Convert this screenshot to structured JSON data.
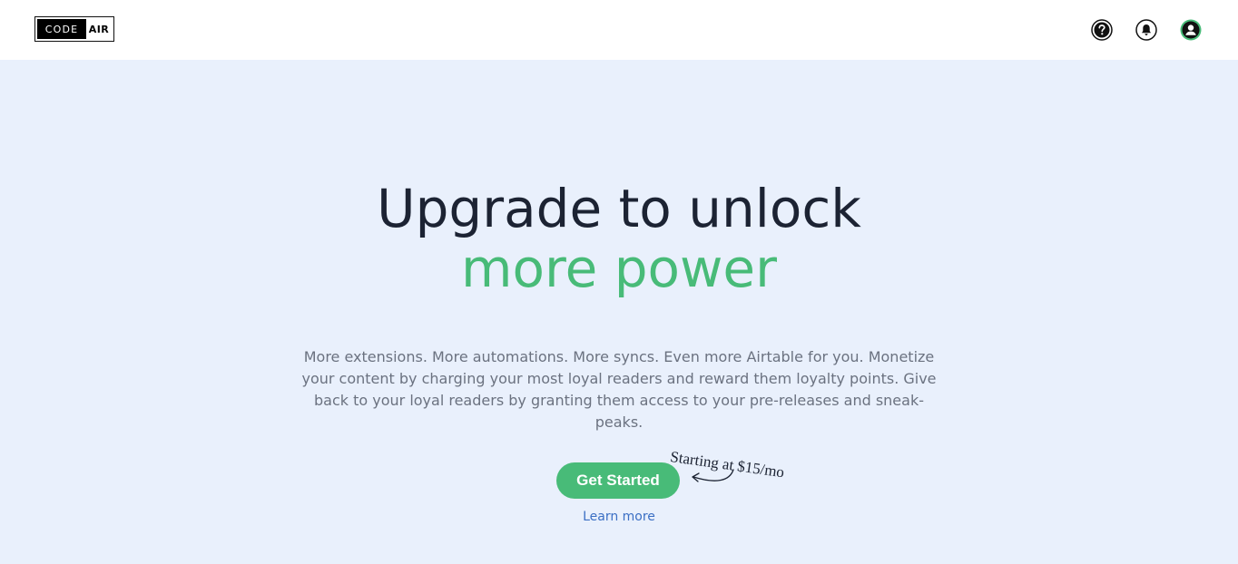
{
  "header": {
    "logo": {
      "left": "CODE",
      "right": "AIR"
    },
    "icons": [
      "help-icon",
      "bell-icon",
      "user-icon"
    ]
  },
  "hero": {
    "headline_line1": "Upgrade to unlock",
    "headline_line2": "more power",
    "description": "More extensions. More automations. More syncs. Even more Airtable for you. Monetize your content by charging your most loyal readers and reward them loyalty points. Give back to your loyal readers by granting them access to your pre-releases and sneak-peaks.",
    "cta_label": "Get Started",
    "price_note": "Starting at $15/mo",
    "learn_more": "Learn more"
  },
  "colors": {
    "accent": "#48bb78",
    "hero_bg": "#e9f0fc",
    "heading": "#1c2333",
    "body_text": "#6b7280",
    "link": "#3b6fc4"
  }
}
